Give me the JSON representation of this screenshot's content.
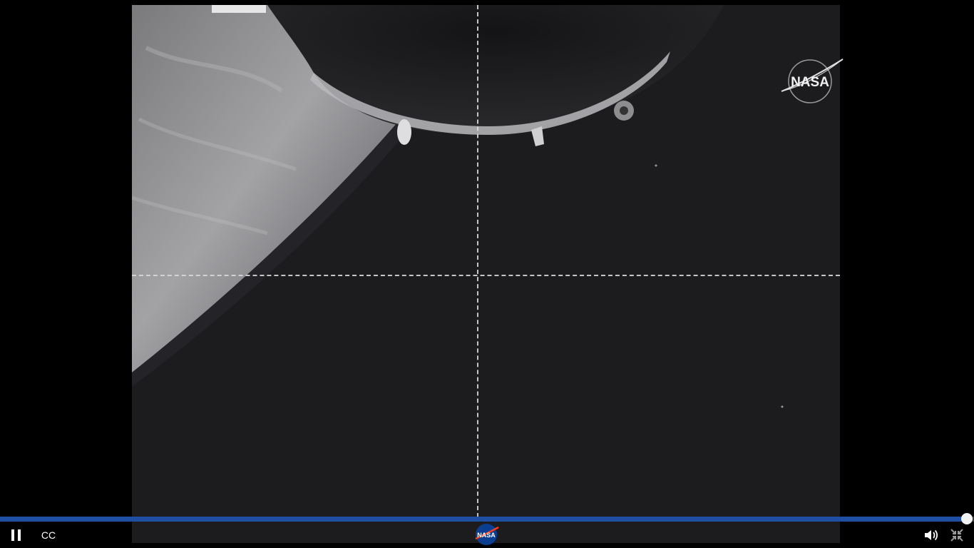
{
  "player": {
    "progress_fraction": 0.993,
    "accent_color": "#1f4fa3",
    "controls": {
      "pause_icon": "pause-icon",
      "cc_label": "CC",
      "center_logo": "nasa-logo-icon",
      "volume_icon": "volume-icon",
      "exit_fullscreen_icon": "exit-fullscreen-icon"
    }
  },
  "video": {
    "watermark_text": "NASA",
    "logo_text": "NASA"
  }
}
